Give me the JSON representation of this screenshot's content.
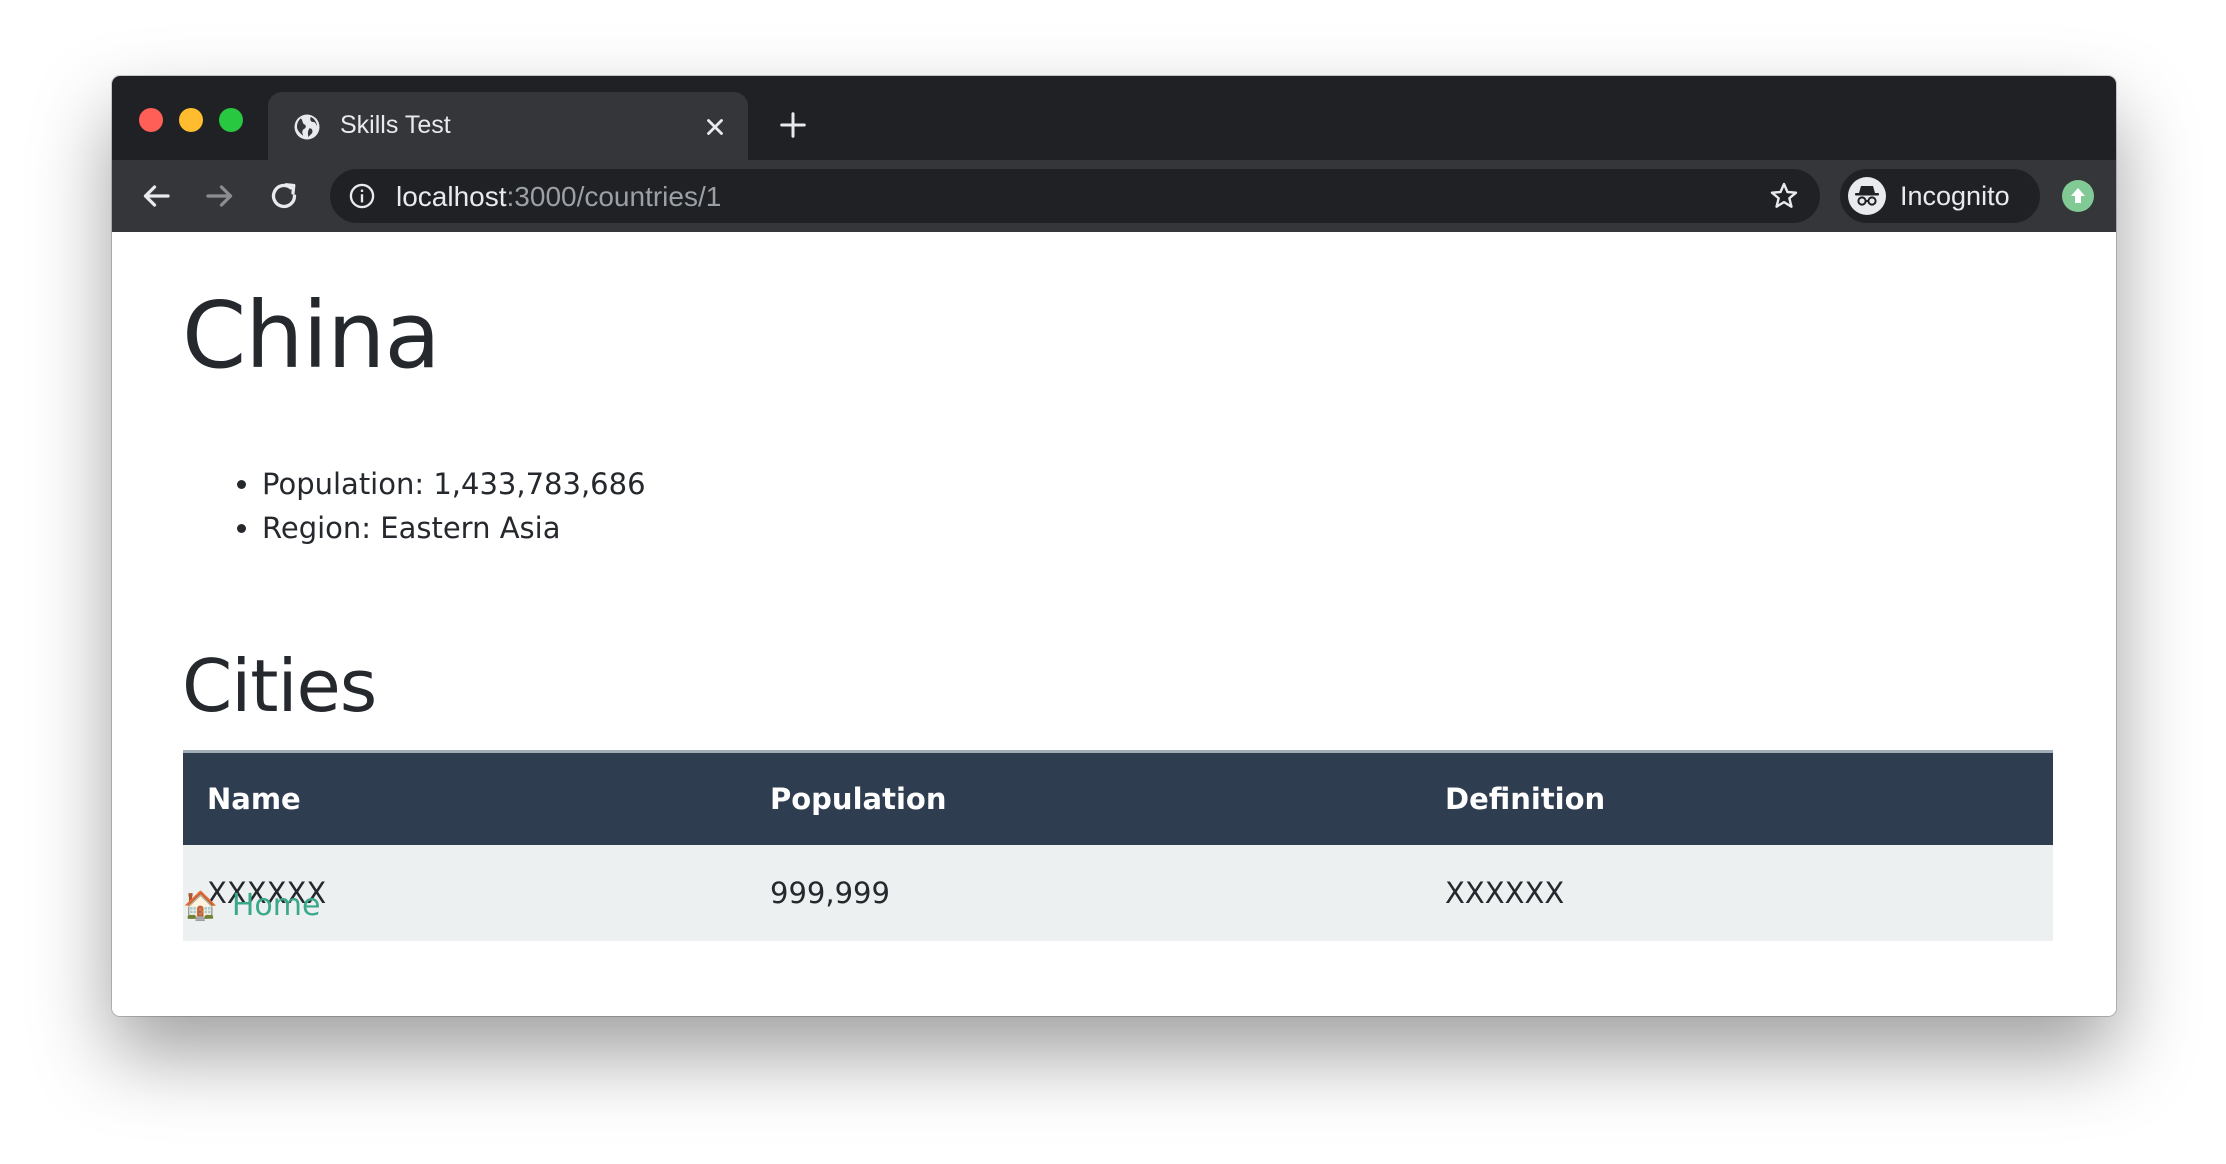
{
  "browser": {
    "tab_title": "Skills Test",
    "url_host": "localhost",
    "url_path": ":3000/countries/1",
    "profile_label": "Incognito",
    "icons": {
      "tab_favicon": "globe-icon",
      "tab_close": "close-icon",
      "new_tab": "plus-icon",
      "back": "arrow-left-icon",
      "forward": "arrow-right-icon",
      "reload": "reload-icon",
      "site_info": "info-icon",
      "bookmark": "star-icon",
      "profile": "incognito-icon",
      "update": "update-arrow-icon"
    }
  },
  "page": {
    "country": "China",
    "facts": [
      "Population: 1,433,783,686",
      "Region: Eastern Asia"
    ],
    "cities_heading": "Cities",
    "table": {
      "headers": [
        "Name",
        "Population",
        "Definition"
      ],
      "rows": [
        [
          "XXXXXX",
          "999,999",
          "XXXXXX"
        ]
      ]
    },
    "home_link": {
      "icon": "🏠",
      "label": "Home"
    }
  },
  "colors": {
    "table_header_bg": "#2f3d50",
    "table_row_bg": "#ecf0f1",
    "link": "#3aa98a"
  }
}
